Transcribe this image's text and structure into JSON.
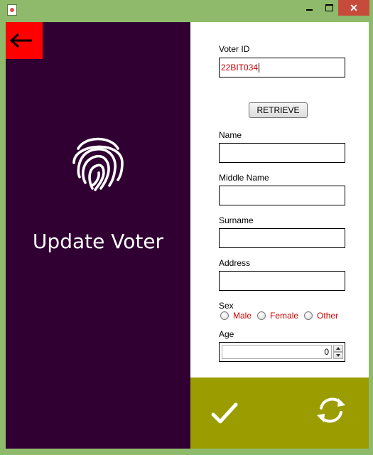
{
  "window": {
    "title": "",
    "frame_color": "#8fba6b",
    "close_color": "#c74b3b"
  },
  "left_panel": {
    "background": "#300033",
    "back_icon": "arrow-left-icon",
    "back_color": "#ff0000",
    "logo_icon": "fingerprint-icon",
    "title": "Update Voter"
  },
  "form": {
    "voter_id": {
      "label": "Voter ID",
      "value": "22BIT034"
    },
    "retrieve_label": "RETRIEVE",
    "name": {
      "label": "Name",
      "value": ""
    },
    "middle_name": {
      "label": "Middle Name",
      "value": ""
    },
    "surname": {
      "label": "Surname",
      "value": ""
    },
    "address": {
      "label": "Address",
      "value": ""
    },
    "sex": {
      "label": "Sex",
      "options": [
        "Male",
        "Female",
        "Other"
      ],
      "selected": null
    },
    "age": {
      "label": "Age",
      "value": "0"
    }
  },
  "actions": {
    "background": "#9b9c00",
    "confirm_icon": "checkmark-icon",
    "refresh_icon": "refresh-icon"
  }
}
